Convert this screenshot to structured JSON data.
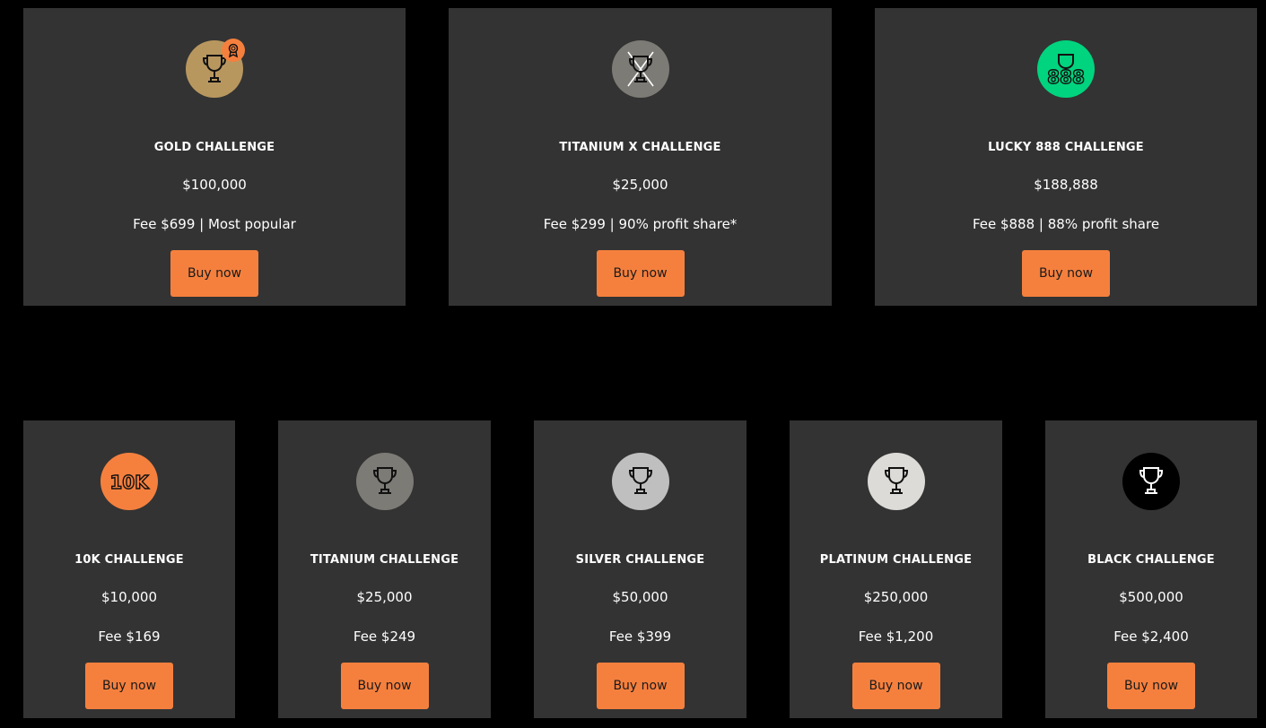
{
  "colors": {
    "background": "#000000",
    "card": "#333333",
    "accent": "#F5803E",
    "text": "#ffffff",
    "button_text": "#1a1a1a"
  },
  "cards": [
    {
      "title": "GOLD CHALLENGE",
      "amount": "$100,000",
      "fee": "Fee $699 | Most popular",
      "button": "Buy now",
      "icon": "gold-trophy-icon",
      "icon_color": "#B8975F"
    },
    {
      "title": "TITANIUM X CHALLENGE",
      "amount": "$25,000",
      "fee": "Fee $299 | 90% profit share*",
      "button": "Buy now",
      "icon": "titanium-x-trophy-icon",
      "icon_color": "#7D7B76"
    },
    {
      "title": "LUCKY 888 CHALLENGE",
      "amount": "$188,888",
      "fee": "Fee $888 | 88% profit share",
      "button": "Buy now",
      "icon": "lucky-888-trophy-icon",
      "icon_color": "#00D47E",
      "icon_text": "888"
    },
    {
      "title": "10K CHALLENGE",
      "amount": "$10,000",
      "fee": "Fee $169",
      "button": "Buy now",
      "icon": "10k-icon",
      "icon_color": "#F5803E",
      "icon_text": "10K"
    },
    {
      "title": "TITANIUM CHALLENGE",
      "amount": "$25,000",
      "fee": "Fee $249",
      "button": "Buy now",
      "icon": "titanium-trophy-icon",
      "icon_color": "#7D7B76"
    },
    {
      "title": "SILVER CHALLENGE",
      "amount": "$50,000",
      "fee": "Fee $399",
      "button": "Buy now",
      "icon": "silver-trophy-icon",
      "icon_color": "#BFBFBF"
    },
    {
      "title": "PLATINUM CHALLENGE",
      "amount": "$250,000",
      "fee": "Fee $1,200",
      "button": "Buy now",
      "icon": "platinum-trophy-icon",
      "icon_color": "#DCDBD7"
    },
    {
      "title": "BLACK CHALLENGE",
      "amount": "$500,000",
      "fee": "Fee $2,400",
      "button": "Buy now",
      "icon": "black-trophy-icon",
      "icon_color": "#000000"
    }
  ]
}
